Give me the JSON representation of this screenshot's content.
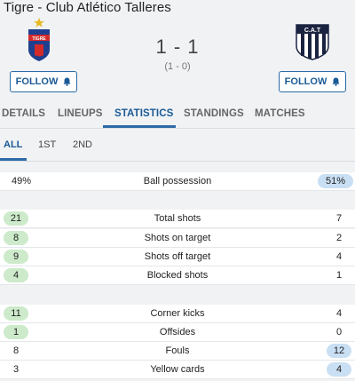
{
  "match": {
    "title": "Tigre - Club Atlético Talleres",
    "score": "1 - 1",
    "halftime": "(1 - 0)",
    "home_follow": "FOLLOW",
    "away_follow": "FOLLOW",
    "away_crest_text": "C.A.T"
  },
  "tabs": [
    "DETAILS",
    "LINEUPS",
    "STATISTICS",
    "STANDINGS",
    "MATCHES"
  ],
  "active_tab": "STATISTICS",
  "subtabs": [
    "ALL",
    "1ST",
    "2ND"
  ],
  "active_subtab": "ALL",
  "stats": [
    {
      "label": "Ball possession",
      "home": "49%",
      "away": "51%",
      "leader": "away"
    },
    {
      "label": "Total shots",
      "home": "21",
      "away": "7",
      "leader": "home"
    },
    {
      "label": "Shots on target",
      "home": "8",
      "away": "2",
      "leader": "home"
    },
    {
      "label": "Shots off target",
      "home": "9",
      "away": "4",
      "leader": "home"
    },
    {
      "label": "Blocked shots",
      "home": "4",
      "away": "1",
      "leader": "home"
    },
    {
      "label": "Corner kicks",
      "home": "11",
      "away": "4",
      "leader": "home"
    },
    {
      "label": "Offsides",
      "home": "1",
      "away": "0",
      "leader": "home"
    },
    {
      "label": "Fouls",
      "home": "8",
      "away": "12",
      "leader": "away"
    },
    {
      "label": "Yellow cards",
      "home": "3",
      "away": "4",
      "leader": "away"
    }
  ],
  "colors": {
    "accent": "#1a5a96",
    "home_highlight": "#cdeacb",
    "away_highlight": "#c9dff3"
  }
}
